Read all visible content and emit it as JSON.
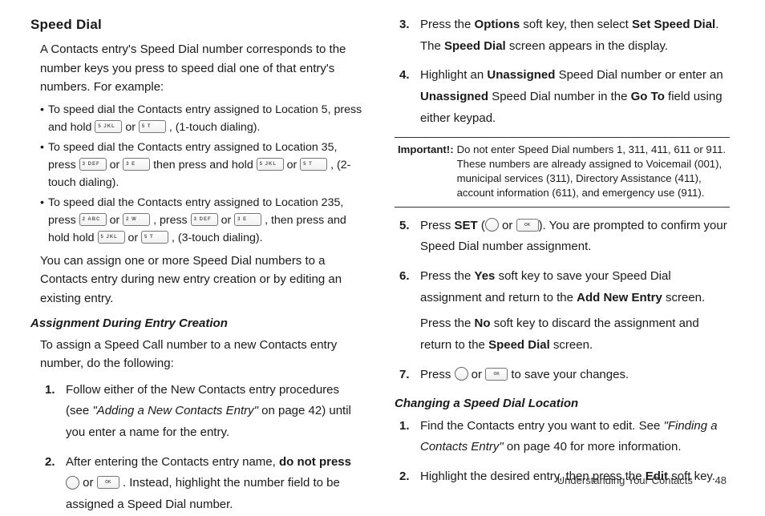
{
  "left": {
    "heading": "Speed Dial",
    "intro": "A Contacts entry's Speed Dial number corresponds to the number keys you press to speed dial one of that entry's numbers. For example:",
    "bullet1_a": "To speed dial the Contacts entry assigned to Location 5, press and hold ",
    "bullet1_b": " or ",
    "bullet1_c": ", (1-touch dialing).",
    "bullet2_a": "To speed dial the Contacts entry assigned to Location 35, press ",
    "bullet2_b": " or ",
    "bullet2_c": " then press and hold ",
    "bullet2_d": " or ",
    "bullet2_e": ", (2-touch dialing).",
    "bullet3_a": "To speed dial the Contacts entry assigned to Location 235, press ",
    "bullet3_b": " or ",
    "bullet3_c": ", press ",
    "bullet3_d": " or ",
    "bullet3_e": ", then press and hold hold ",
    "bullet3_f": " or ",
    "bullet3_g": ", (3-touch dialing).",
    "para_assign": "You can assign one or more Speed Dial numbers to a Contacts entry during new entry creation or by editing an existing entry.",
    "sub_heading": "Assignment During Entry Creation",
    "sub_intro": "To assign a Speed Call number to a new Contacts entry number, do the following:",
    "step1_a": "Follow either of the New Contacts entry procedures (see ",
    "step1_ref": "\"Adding a New Contacts Entry\"",
    "step1_b": " on page 42) until you enter a name for the entry.",
    "step2_a": "After entering the Contacts entry name, ",
    "step2_bold": "do not press",
    "step2_b": " or ",
    "step2_c": ". Instead, highlight the number field to be assigned a Speed Dial number."
  },
  "right": {
    "step3_a": "Press the ",
    "step3_b1": "Options",
    "step3_c": " soft key, then select ",
    "step3_b2": "Set Speed Dial",
    "step3_d": ". The ",
    "step3_b3": "Speed Dial",
    "step3_e": " screen appears in the display.",
    "step4_a": "Highlight an ",
    "step4_b1": "Unassigned",
    "step4_b": " Speed Dial number or enter an ",
    "step4_b2": "Unassigned",
    "step4_c": " Speed Dial number in the ",
    "step4_b3": "Go To",
    "step4_d": " field using either keypad.",
    "important_label": "Important!:",
    "important_text": "Do not enter Speed Dial numbers 1, 311, 411, 611 or 911. These numbers are already assigned to Voicemail (001), municipal services (311), Directory Assistance (411), account information (611), and emergency use (911).",
    "step5_a": "Press ",
    "step5_b1": "SET",
    "step5_b": " (",
    "step5_c": " or ",
    "step5_d": "). You are prompted to confirm your Speed Dial number assignment.",
    "step6_a": "Press the ",
    "step6_b1": "Yes",
    "step6_b": " soft key to save your Speed Dial assignment and return to the ",
    "step6_b2": "Add New Entry",
    "step6_c": " screen.",
    "step6_extra_a": "Press the ",
    "step6_extra_b1": "No",
    "step6_extra_b": " soft key to discard the assignment and return to the ",
    "step6_extra_b2": "Speed Dial",
    "step6_extra_c": " screen.",
    "step7_a": "Press ",
    "step7_b": " or ",
    "step7_c": " to save your changes.",
    "sub_heading2": "Changing a Speed Dial Location",
    "c_step1_a": "Find the Contacts entry you want to edit. See ",
    "c_step1_ref": "\"Finding a Contacts Entry\"",
    "c_step1_b": " on page 40 for more information.",
    "c_step2_a": "Highlight the desired entry, then press the ",
    "c_step2_b1": "Edit",
    "c_step2_b": " soft key."
  },
  "keys": {
    "k5": "5  JKL",
    "k5t": "5  T",
    "k3": "3  DEF",
    "k3e": "3  E",
    "k2": "2  ABC",
    "k2w": "2  W",
    "ok": "OK"
  },
  "footer": {
    "section": "Understanding Your Contacts",
    "page": "48"
  }
}
